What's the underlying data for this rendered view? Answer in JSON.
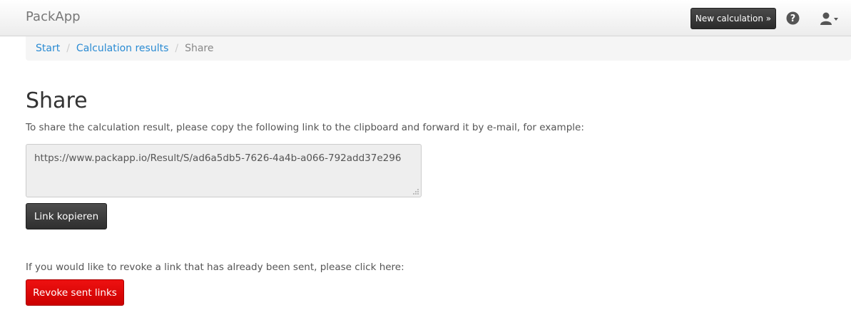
{
  "navbar": {
    "brand": "PackApp",
    "new_calculation_label": "New calculation »",
    "help_icon": "question-circle-icon",
    "user_icon": "user-dropdown-icon"
  },
  "breadcrumb": {
    "items": [
      "Start",
      "Calculation results",
      "Share"
    ],
    "separator": "/"
  },
  "main": {
    "title": "Share",
    "intro": "To share the calculation result, please copy the following link to the clipboard and forward it by e-mail, for example:",
    "share_link": "https://www.packapp.io/Result/S/ad6a5db5-7626-4a4b-a066-792add37e296",
    "copy_button_label": "Link kopieren",
    "revoke_text": "If you would like to revoke a link that has already been sent, please click here:",
    "revoke_button_label": "Revoke sent links"
  },
  "colors": {
    "link": "#2a8bd3",
    "dark_button": "#333333",
    "danger_button": "#dd0000"
  }
}
